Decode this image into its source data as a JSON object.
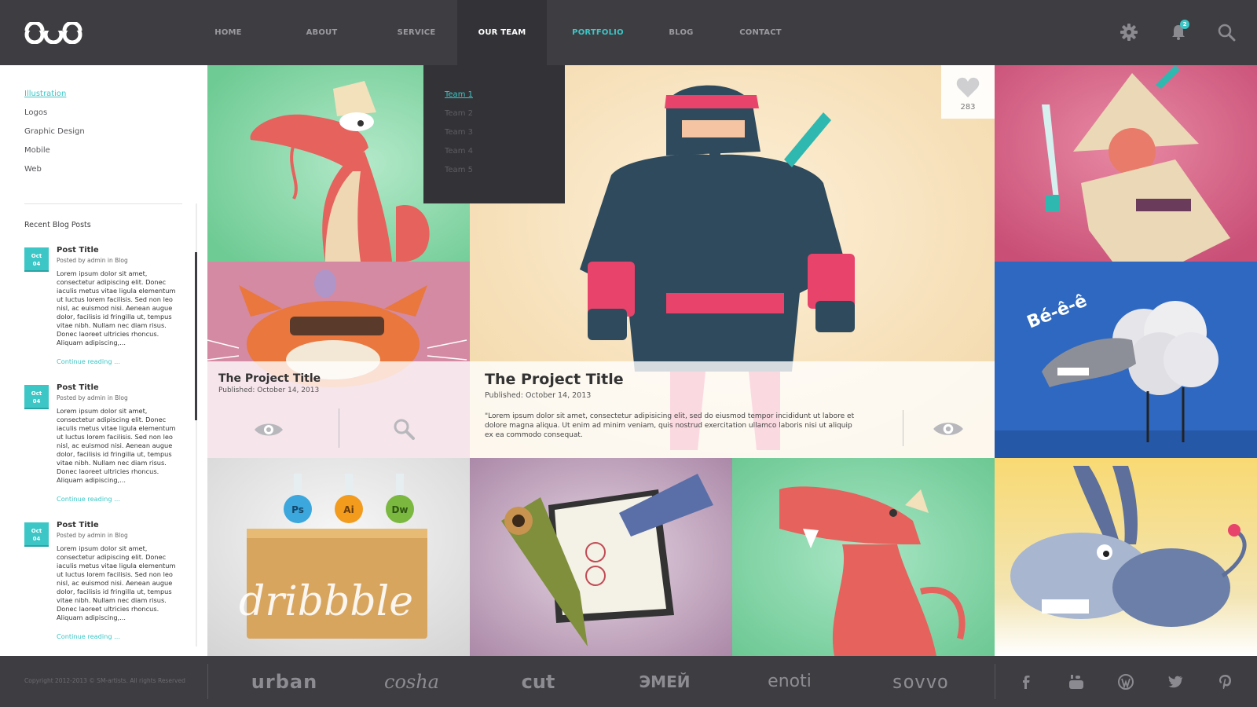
{
  "nav": {
    "items": [
      "HOME",
      "ABOUT",
      "SERVICE",
      "OUR TEAM",
      "PORTFOLIO",
      "BLOG",
      "CONTACT"
    ],
    "notifications_count": "2"
  },
  "dropdown": {
    "items": [
      "Team 1",
      "Team 2",
      "Team 3",
      "Team 4",
      "Team 5"
    ]
  },
  "sidebar": {
    "categories": [
      "Illustration",
      "Logos",
      "Graphic Design",
      "Mobile",
      "Web"
    ],
    "recent_title": "Recent Blog Posts",
    "posts": [
      {
        "month": "Oct",
        "day": "04",
        "title": "Post Title",
        "meta": "Posted by admin in Blog",
        "body": "Lorem ipsum dolor sit amet, consectetur adipiscing elit. Donec iaculis metus vitae ligula elementum ut luctus lorem facilisis. Sed non leo nisl, ac euismod nisi. Aenean augue dolor, facilisis id fringilla ut, tempus vitae nibh. Nullam nec diam risus. Donec laoreet ultricies rhoncus. Aliquam adipiscing,...",
        "more": "Continue reading ..."
      },
      {
        "month": "Oct",
        "day": "04",
        "title": "Post Title",
        "meta": "Posted by admin in Blog",
        "body": "Lorem ipsum dolor sit amet, consectetur adipiscing elit. Donec iaculis metus vitae ligula elementum ut luctus lorem facilisis. Sed non leo nisl, ac euismod nisi. Aenean augue dolor, facilisis id fringilla ut, tempus vitae nibh. Nullam nec diam risus. Donec laoreet ultricies rhoncus. Aliquam adipiscing,...",
        "more": "Continue reading ..."
      },
      {
        "month": "Oct",
        "day": "04",
        "title": "Post Title",
        "meta": "Posted by admin in Blog",
        "body": "Lorem ipsum dolor sit amet, consectetur adipiscing elit. Donec iaculis metus vitae ligula elementum ut luctus lorem facilisis. Sed non leo nisl, ac euismod nisi. Aenean augue dolor, facilisis id fringilla ut, tempus vitae nibh. Nullam nec diam risus. Donec laoreet ultricies rhoncus. Aliquam adipiscing,...",
        "more": "Continue reading ..."
      }
    ]
  },
  "projects": {
    "small": {
      "title": "The Project Title",
      "date": "Published: October 14, 2013"
    },
    "featured": {
      "title": "The Project Title",
      "date": "Published: October 14, 2013",
      "excerpt": "\"Lorem ipsum dolor sit amet, consectetur adipisicing elit, sed do eiusmod tempor incididunt ut labore et dolore magna aliqua. Ut enim ad minim veniam, quis nostrud exercitation ullamco laboris nisi ut aliquip ex ea commodo consequat.",
      "likes": "283"
    },
    "sheep_caption": "Bé-ê-ê",
    "flask_labels": [
      "Ps",
      "Ai",
      "Dw"
    ],
    "board_word": "dribbble"
  },
  "footer": {
    "copyright": "Copyright 2012-2013 © SM-artists. All rights Reserved",
    "clients": [
      "urban",
      "cosha",
      "cut",
      "ЭМЕЙ",
      "enoti",
      "sovvo"
    ]
  },
  "colors": {
    "accent": "#3cc6c6",
    "header_bg": "#3e3e42",
    "dropdown_bg": "#333337"
  },
  "icons": [
    "logo-icon",
    "gear-icon",
    "bell-icon",
    "search-icon",
    "heart-icon",
    "eye-icon",
    "facebook-icon",
    "youtube-icon",
    "wordpress-icon",
    "twitter-icon",
    "pinterest-icon"
  ]
}
